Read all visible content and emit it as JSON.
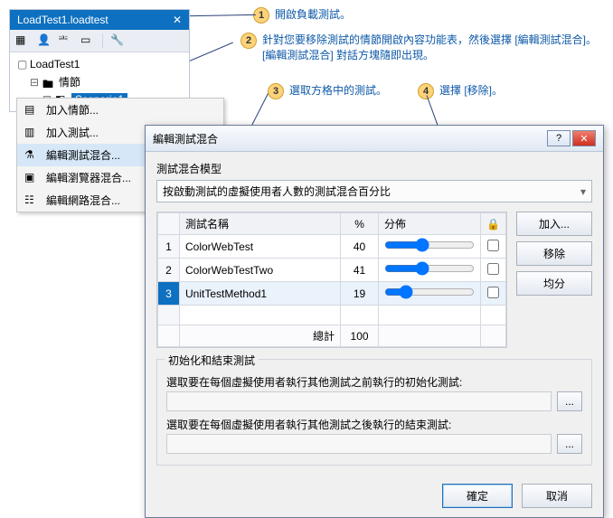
{
  "callouts": {
    "c1": "開啟負載測試。",
    "c2a": "針對您要移除測試的情節開啟內容功能表，然後選擇 [編輯測試混合]。",
    "c2b": "[編輯測試混合] 對話方塊隨即出現。",
    "c3": "選取方格中的測試。",
    "c4": "選擇 [移除]。"
  },
  "tab_title": "LoadTest1.loadtest",
  "tree": {
    "root": "LoadTest1",
    "folder": "情節",
    "scenario": "Scenario1"
  },
  "context_menu": {
    "add_scenario": "加入情節...",
    "add_test": "加入測試...",
    "edit_test_mix": "編輯測試混合...",
    "edit_browser_mix": "編輯瀏覽器混合...",
    "edit_network_mix": "編輯網路混合..."
  },
  "dialog": {
    "title": "編輯測試混合",
    "model_label": "測試混合模型",
    "model_value": "按啟動測試的虛擬使用者人數的測試混合百分比",
    "columns": {
      "name": "測試名稱",
      "pct": "%",
      "dist": "分佈"
    },
    "rows": [
      {
        "n": "1",
        "name": "ColorWebTest",
        "pct": "40"
      },
      {
        "n": "2",
        "name": "ColorWebTestTwo",
        "pct": "41"
      },
      {
        "n": "3",
        "name": "UnitTestMethod1",
        "pct": "19"
      }
    ],
    "total_label": "總計",
    "total_value": "100",
    "buttons": {
      "add": "加入...",
      "remove": "移除",
      "even": "均分"
    },
    "init_group": "初始化和結束測試",
    "init_label": "選取要在每個虛擬使用者執行其他測試之前執行的初始化測試:",
    "cleanup_label": "選取要在每個虛擬使用者執行其他測試之後執行的結束測試:",
    "browse": "...",
    "ok": "確定",
    "cancel": "取消"
  }
}
